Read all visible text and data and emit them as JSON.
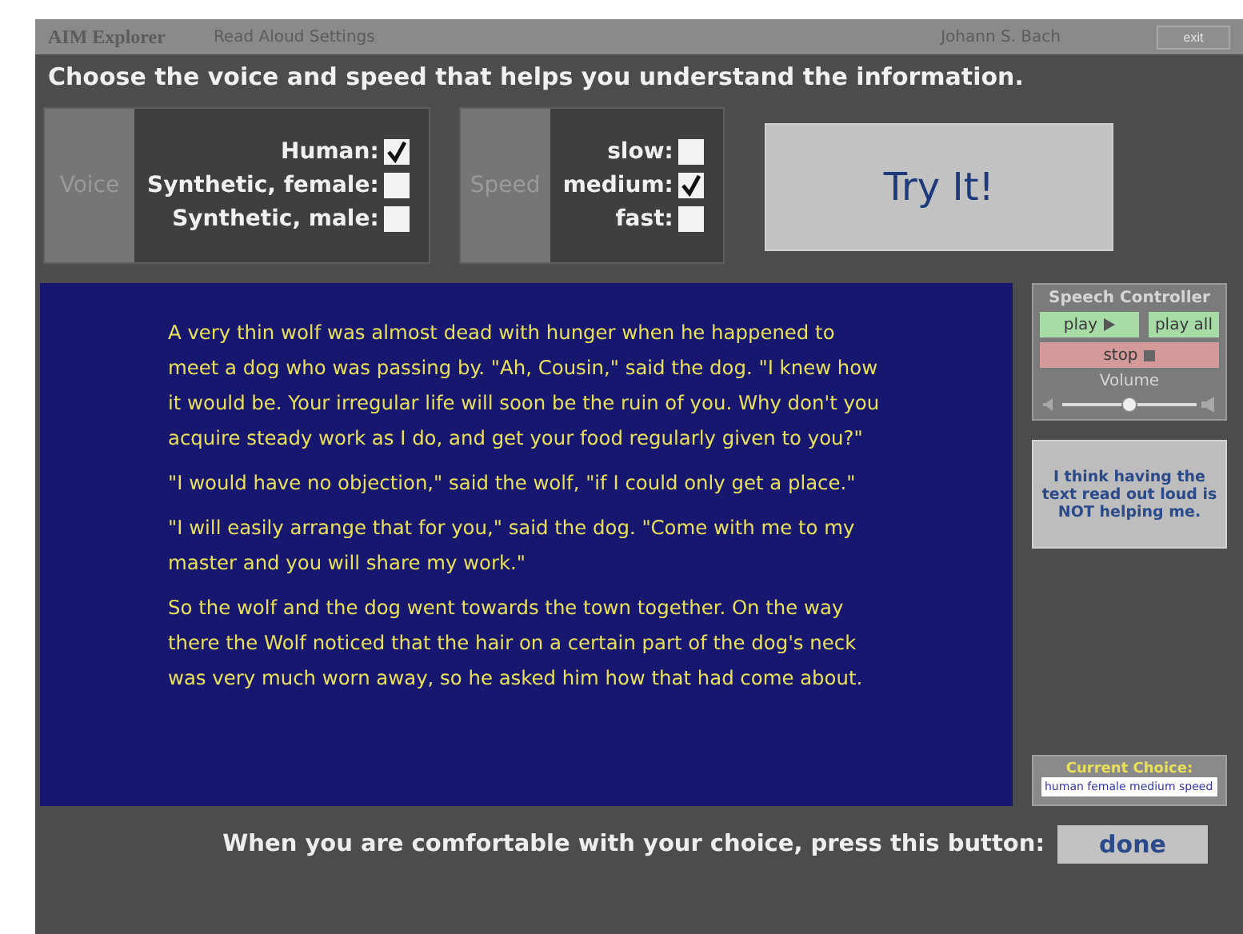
{
  "title_bar": {
    "app_name": "AIM Explorer",
    "section": "Read Aloud Settings",
    "user": "Johann S. Bach",
    "exit_button": "exit"
  },
  "instruction": "Choose the voice and speed that helps you understand the information.",
  "voice": {
    "label": "Voice",
    "options": [
      {
        "label": "Human:",
        "checked": true
      },
      {
        "label": "Synthetic, female:",
        "checked": false
      },
      {
        "label": "Synthetic, male:",
        "checked": false
      }
    ]
  },
  "speed": {
    "label": "Speed",
    "options": [
      {
        "label": "slow:",
        "checked": false
      },
      {
        "label": "medium:",
        "checked": true
      },
      {
        "label": "fast:",
        "checked": false
      }
    ]
  },
  "try_button": "Try It!",
  "story": [
    "A very thin wolf was almost dead with hunger when he happened to meet a dog who was passing by. \"Ah, Cousin,\" said the dog. \"I knew how it would be. Your irregular life will soon be the ruin of you. Why don't you acquire steady work as I do, and get your food regularly given to you?\"",
    "\"I would have no objection,\" said the wolf, \"if I could only get a place.\"",
    "\"I will easily arrange that for you,\" said the dog. \"Come with me to my master and you will share my work.\"",
    "So the wolf and the dog went towards the town together. On the way there the Wolf noticed that the hair on a certain part of the dog's neck was very much worn away, so he asked him how that had come about."
  ],
  "speech_controller": {
    "title": "Speech Controller",
    "play": "play",
    "play_all": "play all",
    "stop": "stop",
    "volume_label": "Volume",
    "volume": {
      "level": 0.5
    }
  },
  "not_helping_button": "I think having the text read out loud is NOT helping me.",
  "current_choice": {
    "label": "Current Choice:",
    "value": "human female medium speed"
  },
  "footer": {
    "prompt": "When you are comfortable with your choice, press this button:",
    "done_button": "done"
  }
}
